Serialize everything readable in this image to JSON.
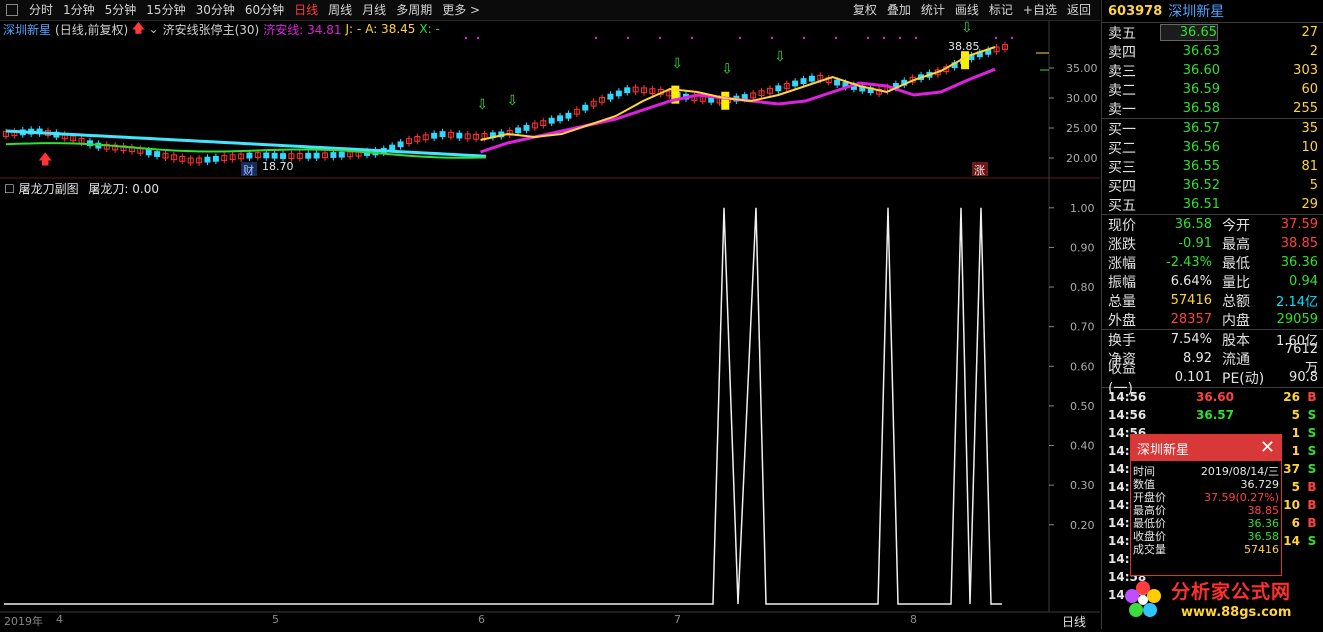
{
  "toolbar": {
    "periods": [
      "分时",
      "1分钟",
      "5分钟",
      "15分钟",
      "30分钟",
      "60分钟",
      "日线",
      "周线",
      "月线",
      "多周期",
      "更多 >"
    ],
    "active": "日线",
    "actions": [
      "复权",
      "叠加",
      "统计",
      "画线",
      "标记",
      "+自选",
      "返回"
    ]
  },
  "info": {
    "stock": "深圳新星",
    "mode": "(日线,前复权)",
    "indicator": "济安线张停主(30)",
    "jian_label": "济安线: 34.81",
    "j_label": "J: -",
    "a_label": "A: 38.45",
    "x_label": "X: -"
  },
  "main_axis": {
    "ticks": [
      "35.00",
      "30.00",
      "25.00",
      "20.00"
    ],
    "min": 17,
    "max": 40
  },
  "price_annotations": {
    "high": "38.85",
    "low": "18.70",
    "badge_cai": "财",
    "badge_zhang": "涨"
  },
  "sub": {
    "title": "屠龙刀副图",
    "value_label": "屠龙刀: 0.00",
    "ticks": [
      "1.00",
      "0.90",
      "0.80",
      "0.70",
      "0.60",
      "0.50",
      "0.40",
      "0.30",
      "0.20"
    ]
  },
  "xaxis": {
    "labels": [
      "2019年",
      "4",
      "5",
      "6",
      "7",
      "8"
    ],
    "period_btn": "日线"
  },
  "chart_data": [
    {
      "type": "line",
      "title": "",
      "series": [
        {
          "name": "济安线",
          "values": [
            24.5,
            24.0,
            23.5,
            22.5,
            22.0,
            21.5,
            21.3,
            21.0,
            20.8,
            20.6,
            20.5,
            20.4,
            20.5,
            21.0,
            22.5,
            23.5,
            24.5,
            25.5,
            26.5,
            28.0,
            29.5,
            30.5,
            30.0,
            29.5,
            29.0,
            29.5,
            31.0,
            32.5,
            32.0,
            30.5,
            31.0,
            33.0,
            34.8
          ],
          "color": "#e020e0"
        },
        {
          "name": "J",
          "values": [
            24.0,
            24.5,
            23.5,
            22.0,
            21.5,
            20.5,
            19.5,
            20.0,
            20.5,
            20.3,
            20.4,
            20.6,
            21.0,
            23.0,
            24.0,
            23.5,
            24.0,
            25.5,
            27.0,
            29.5,
            31.5,
            31.0,
            30.0,
            29.5,
            30.5,
            32.0,
            33.5,
            32.0,
            31.0,
            33.0,
            34.5,
            37.0,
            38.5
          ],
          "color": "#ffd33c"
        }
      ],
      "ylim": [
        17,
        40
      ]
    },
    {
      "type": "line",
      "title": "屠龙刀副图",
      "series": [
        {
          "name": "屠龙刀",
          "values": [
            0,
            0,
            0,
            0,
            0,
            0,
            0,
            0,
            0,
            0,
            0,
            0,
            0,
            0,
            0,
            0,
            0,
            0,
            0,
            0,
            0,
            0,
            1,
            0,
            1,
            0,
            0,
            1,
            0,
            0,
            1,
            0,
            1,
            0,
            0
          ]
        }
      ],
      "ylim": [
        0,
        1.05
      ]
    }
  ],
  "right": {
    "code": "603978",
    "name": "深圳新星",
    "asks": [
      {
        "label": "卖五",
        "price": "36.65",
        "vol": "27"
      },
      {
        "label": "卖四",
        "price": "36.63",
        "vol": "2"
      },
      {
        "label": "卖三",
        "price": "36.60",
        "vol": "303"
      },
      {
        "label": "卖二",
        "price": "36.59",
        "vol": "60"
      },
      {
        "label": "卖一",
        "price": "36.58",
        "vol": "255"
      }
    ],
    "bids": [
      {
        "label": "买一",
        "price": "36.57",
        "vol": "35"
      },
      {
        "label": "买二",
        "price": "36.56",
        "vol": "10"
      },
      {
        "label": "买三",
        "price": "36.55",
        "vol": "81"
      },
      {
        "label": "买四",
        "price": "36.52",
        "vol": "5"
      },
      {
        "label": "买五",
        "price": "36.51",
        "vol": "29"
      }
    ],
    "quotes": [
      {
        "l1": "现价",
        "v1": "36.58",
        "c1": "green",
        "l2": "今开",
        "v2": "37.59",
        "c2": "red"
      },
      {
        "l1": "涨跌",
        "v1": "-0.91",
        "c1": "green",
        "l2": "最高",
        "v2": "38.85",
        "c2": "red"
      },
      {
        "l1": "涨幅",
        "v1": "-2.43%",
        "c1": "green",
        "l2": "最低",
        "v2": "36.36",
        "c2": "green"
      },
      {
        "l1": "振幅",
        "v1": "6.64%",
        "c1": "white",
        "l2": "量比",
        "v2": "0.94",
        "c2": "green"
      },
      {
        "l1": "总量",
        "v1": "57416",
        "c1": "yellow",
        "l2": "总额",
        "v2": "2.14亿",
        "c2": "cyan"
      },
      {
        "l1": "外盘",
        "v1": "28357",
        "c1": "red",
        "l2": "内盘",
        "v2": "29059",
        "c2": "green"
      }
    ],
    "finance": [
      {
        "l1": "换手",
        "v1": "7.54%",
        "l2": "股本",
        "v2": "1.60亿"
      },
      {
        "l1": "净资",
        "v1": "8.92",
        "l2": "流通",
        "v2": "7612万"
      },
      {
        "l1": "收益(一)",
        "v1": "0.101",
        "l2": "PE(动)",
        "v2": "90.8"
      }
    ],
    "ticks": [
      {
        "time": "14:56",
        "price": "36.60",
        "vol": "26",
        "bs": "B"
      },
      {
        "time": "14:56",
        "price": "36.57",
        "vol": "5",
        "bs": "S"
      },
      {
        "time": "14:56",
        "price": "",
        "vol": "1",
        "bs": "S"
      },
      {
        "time": "14:56",
        "price": "",
        "vol": "1",
        "bs": "S"
      },
      {
        "time": "14:56",
        "price": "",
        "vol": "37",
        "bs": "S"
      },
      {
        "time": "14:57",
        "price": "",
        "vol": "5",
        "bs": "B"
      },
      {
        "time": "14:57",
        "price": "",
        "vol": "10",
        "bs": "B"
      },
      {
        "time": "14:57",
        "price": "",
        "vol": "6",
        "bs": "B"
      },
      {
        "time": "14:57",
        "price": "",
        "vol": "14",
        "bs": "S"
      },
      {
        "time": "14:57",
        "price": "",
        "vol": "",
        "bs": ""
      },
      {
        "time": "14:58",
        "price": "",
        "vol": "",
        "bs": ""
      },
      {
        "time": "14:59",
        "price": "",
        "vol": "",
        "bs": ""
      }
    ]
  },
  "popup": {
    "title": "深圳新星",
    "rows": [
      {
        "l": "时间",
        "v": "2019/08/14/三",
        "c": "white"
      },
      {
        "l": "数值",
        "v": "36.729",
        "c": "white"
      },
      {
        "l": "开盘价",
        "v": "37.59(0.27%)",
        "c": "red"
      },
      {
        "l": "最高价",
        "v": "38.85",
        "c": "red"
      },
      {
        "l": "最低价",
        "v": "36.36",
        "c": "green"
      },
      {
        "l": "收盘价",
        "v": "36.58",
        "c": "green"
      },
      {
        "l": "成交量",
        "v": "57416",
        "c": "yellow"
      }
    ]
  },
  "logo": {
    "text": "分析家公式网",
    "url": "www.88gs.com"
  }
}
